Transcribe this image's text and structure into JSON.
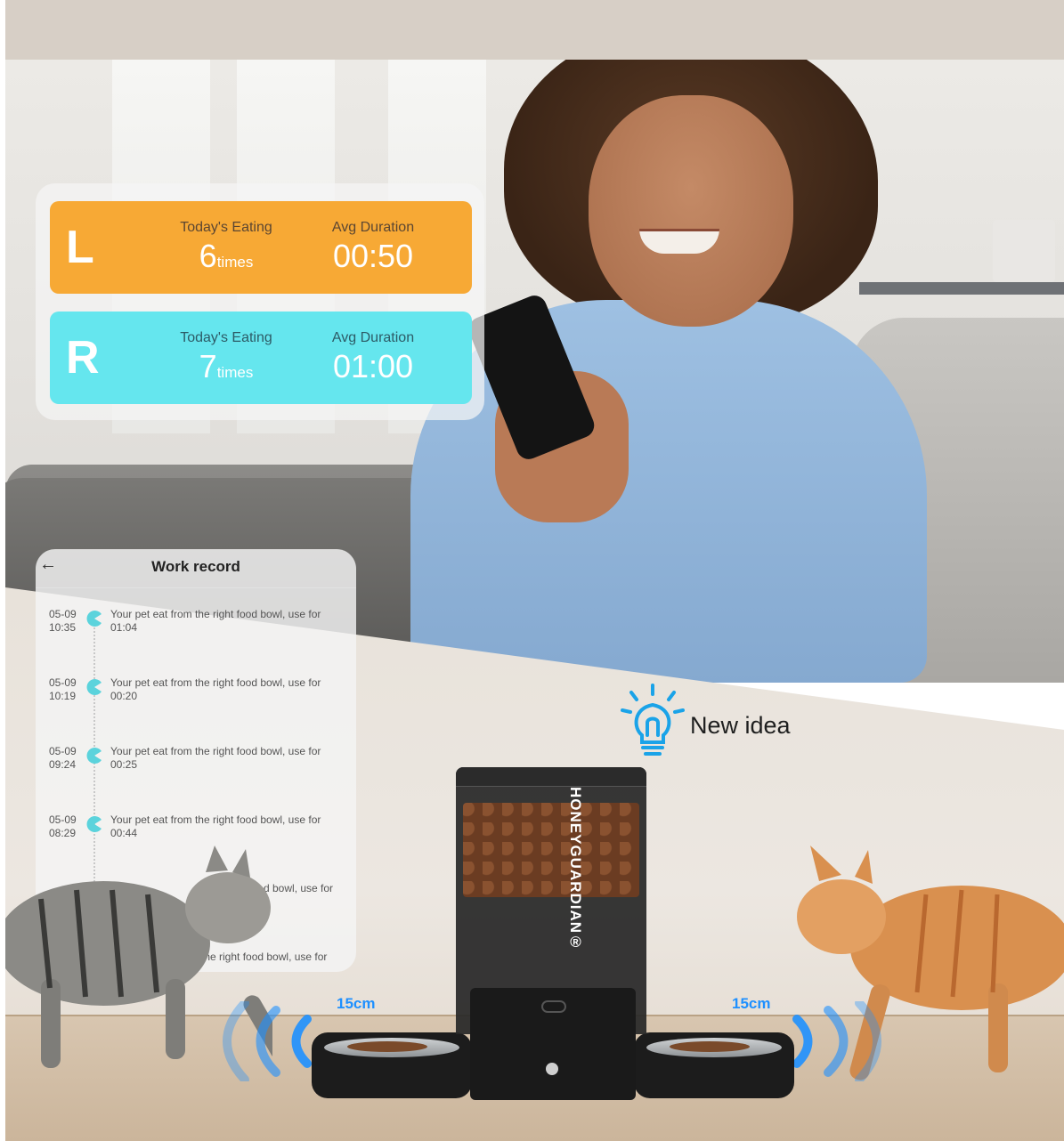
{
  "eating_stats": {
    "left": {
      "side": "L",
      "eating_label": "Today's Eating",
      "eating_count": "6",
      "eating_unit": "times",
      "duration_label": "Avg Duration",
      "duration_value": "00:50",
      "color": "#f7a935"
    },
    "right": {
      "side": "R",
      "eating_label": "Today's Eating",
      "eating_count": "7",
      "eating_unit": "times",
      "duration_label": "Avg Duration",
      "duration_value": "01:00",
      "color": "#65e6ee"
    }
  },
  "work_record": {
    "back_icon": "arrow-left-icon",
    "title": "Work record",
    "records": [
      {
        "date": "05-09",
        "time": "10:35",
        "text": "Your pet eat from the right food bowl, use for",
        "duration": "01:04"
      },
      {
        "date": "05-09",
        "time": "10:19",
        "text": "Your pet eat from the right food bowl, use for",
        "duration": "00:20"
      },
      {
        "date": "05-09",
        "time": "09:24",
        "text": "Your pet eat from the right food bowl, use for",
        "duration": "00:25"
      },
      {
        "date": "05-09",
        "time": "08:29",
        "text": "Your pet eat from the right food bowl, use for",
        "duration": "00:44"
      },
      {
        "date": "",
        "time": "",
        "text": "d bowl, use for",
        "duration": ""
      },
      {
        "date": "",
        "time": "",
        "text": "the right food bowl, use for",
        "duration": ""
      }
    ],
    "record_icon": "pacman-eat-icon",
    "accent": "#5bd3dc"
  },
  "idea": {
    "icon": "lightbulb-icon",
    "label": "New idea",
    "color": "#1aa3e8"
  },
  "product": {
    "brand": "HONEYGUARDIAN®",
    "range_left": "15cm",
    "range_right": "15cm",
    "range_color": "#1e90ff"
  }
}
